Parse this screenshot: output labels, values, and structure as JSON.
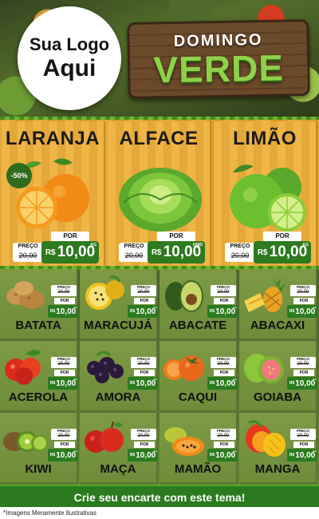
{
  "header": {
    "logo_line1": "Sua Logo",
    "logo_line2": "Aqui",
    "title_top": "DOMINGO",
    "title_main": "VERDE"
  },
  "featured": [
    {
      "name": "LARANJA",
      "icon": "orange-icon",
      "badge": "-50%",
      "preco_label": "PREÇO",
      "old_price": "20,00",
      "por_label": "POR",
      "currency": "R$",
      "price": "10,00",
      "unit": "KG"
    },
    {
      "name": "ALFACE",
      "icon": "lettuce-icon",
      "preco_label": "PREÇO",
      "old_price": "20,00",
      "por_label": "POR",
      "currency": "R$",
      "price": "10,00",
      "unit": "UNID"
    },
    {
      "name": "LIMÃO",
      "icon": "lime-icon",
      "preco_label": "PREÇO",
      "old_price": "20,00",
      "por_label": "POR",
      "currency": "R$",
      "price": "10,00",
      "unit": "KG"
    }
  ],
  "products": [
    {
      "name": "BATATA",
      "icon": "potato-icon",
      "preco_label": "PREÇO",
      "old_price": "20,00",
      "por_label": "POR",
      "currency": "R$",
      "price": "10,00",
      "unit": "KG"
    },
    {
      "name": "MARACUJÁ",
      "icon": "passion-fruit-icon",
      "preco_label": "PREÇO",
      "old_price": "20,00",
      "por_label": "POR",
      "currency": "R$",
      "price": "10,00",
      "unit": "KG"
    },
    {
      "name": "ABACATE",
      "icon": "avocado-icon",
      "preco_label": "PREÇO",
      "old_price": "20,00",
      "por_label": "POR",
      "currency": "R$",
      "price": "10,00",
      "unit": "KG"
    },
    {
      "name": "ABACAXI",
      "icon": "pineapple-icon",
      "preco_label": "PREÇO",
      "old_price": "20,00",
      "por_label": "POR",
      "currency": "R$",
      "price": "10,00",
      "unit": "KG"
    },
    {
      "name": "ACEROLA",
      "icon": "acerola-icon",
      "preco_label": "PREÇO",
      "old_price": "20,00",
      "por_label": "POR",
      "currency": "R$",
      "price": "10,00",
      "unit": "KG"
    },
    {
      "name": "AMORA",
      "icon": "blackberry-icon",
      "preco_label": "PREÇO",
      "old_price": "20,00",
      "por_label": "POR",
      "currency": "R$",
      "price": "10,00",
      "unit": "KG"
    },
    {
      "name": "CAQUI",
      "icon": "persimmon-icon",
      "preco_label": "PREÇO",
      "old_price": "20,00",
      "por_label": "POR",
      "currency": "R$",
      "price": "10,00",
      "unit": "KG"
    },
    {
      "name": "GOIABA",
      "icon": "guava-icon",
      "preco_label": "PREÇO",
      "old_price": "20,00",
      "por_label": "POR",
      "currency": "R$",
      "price": "10,00",
      "unit": "KG"
    },
    {
      "name": "KIWI",
      "icon": "kiwi-icon",
      "preco_label": "PREÇO",
      "old_price": "20,00",
      "por_label": "POR",
      "currency": "R$",
      "price": "10,00",
      "unit": "KG"
    },
    {
      "name": "MAÇA",
      "icon": "apple-icon",
      "preco_label": "PREÇO",
      "old_price": "20,00",
      "por_label": "POR",
      "currency": "R$",
      "price": "10,00",
      "unit": "KG"
    },
    {
      "name": "MAMÃO",
      "icon": "papaya-icon",
      "preco_label": "PREÇO",
      "old_price": "20,00",
      "por_label": "POR",
      "currency": "R$",
      "price": "10,00",
      "unit": "KG"
    },
    {
      "name": "MANGA",
      "icon": "mango-icon",
      "preco_label": "PREÇO",
      "old_price": "20,00",
      "por_label": "POR",
      "currency": "R$",
      "price": "10,00",
      "unit": "KG"
    }
  ],
  "footer": {
    "cta": "Crie seu encarte com este tema!",
    "disclaimer": "*Imagens Meramente Ilustrativas"
  },
  "colors": {
    "price_green": "#2d7a1f",
    "title_green": "#8fd14a",
    "panel_orange": "#efb545",
    "grid_green": "#7d9a45"
  }
}
